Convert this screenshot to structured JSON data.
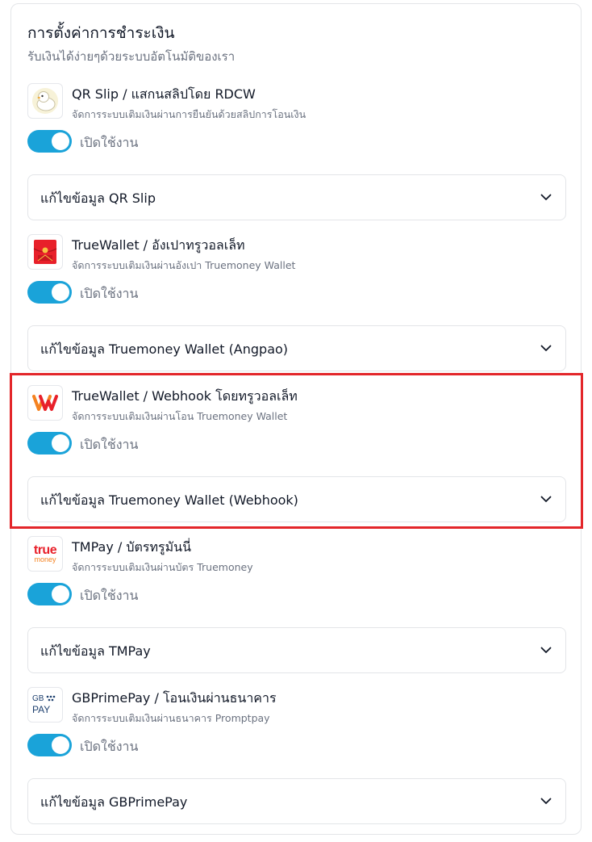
{
  "header": {
    "title": "การตั้งค่าการชำระเงิน",
    "subtitle": "รับเงินได้ง่ายๆด้วยระบบอัตโนมัติของเรา"
  },
  "methods": [
    {
      "icon": "duck-logo-icon",
      "title": "QR Slip / แสกนสลิปโดย RDCW",
      "desc": "จัดการระบบเติมเงินผ่านการยืนยันด้วยสลิปการโอนเงิน",
      "toggle_label": "เปิดใช้งาน",
      "enabled": true,
      "accordion_label": "แก้ไขข้อมูล QR Slip"
    },
    {
      "icon": "red-envelope-icon",
      "title": "TrueWallet / อังเปาทรูวอลเล็ท",
      "desc": "จัดการระบบเติมเงินผ่านอังเปา Truemoney Wallet",
      "toggle_label": "เปิดใช้งาน",
      "enabled": true,
      "accordion_label": "แก้ไขข้อมูล Truemoney Wallet (Angpao)"
    },
    {
      "icon": "truemoney-wallet-logo-icon",
      "title": "TrueWallet / Webhook โดยทรูวอลเล็ท",
      "desc": "จัดการระบบเติมเงินผ่านโอน Truemoney Wallet",
      "toggle_label": "เปิดใช้งาน",
      "enabled": true,
      "accordion_label": "แก้ไขข้อมูล Truemoney Wallet (Webhook)"
    },
    {
      "icon": "true-money-logo-icon",
      "logo_text_top": "true",
      "logo_text_bottom": "money",
      "title": "TMPay / บัตรทรูมันนี่",
      "desc": "จัดการระบบเติมเงินผ่านบัตร Truemoney",
      "toggle_label": "เปิดใช้งาน",
      "enabled": true,
      "accordion_label": "แก้ไขข้อมูล TMPay"
    },
    {
      "icon": "gb-pay-logo-icon",
      "logo_text_top": "GB",
      "logo_text_bottom": "PAY",
      "title": "GBPrimePay / โอนเงินผ่านธนาคาร",
      "desc": "จัดการระบบเติมเงินผ่านธนาคาร Promptpay",
      "toggle_label": "เปิดใช้งาน",
      "enabled": true,
      "accordion_label": "แก้ไขข้อมูล GBPrimePay"
    }
  ],
  "colors": {
    "toggle_on": "#1aa3d9",
    "highlight": "#e3262a",
    "truemoney_red": "#e8202a",
    "truemoney_orange": "#f58220",
    "gbpay_navy": "#1d3f6e"
  }
}
